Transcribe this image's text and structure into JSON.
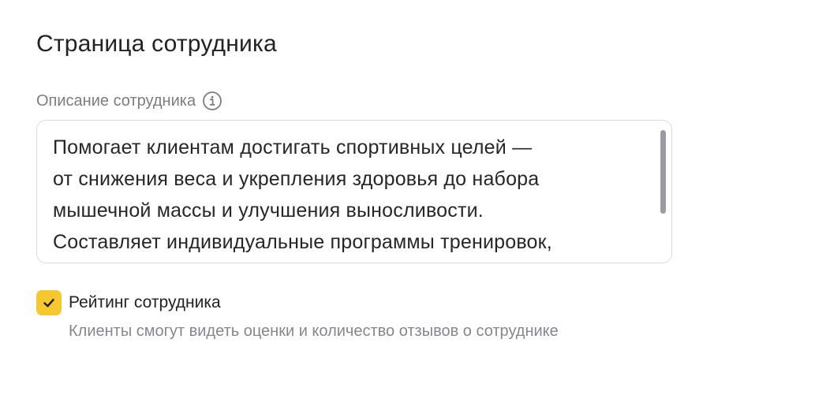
{
  "page": {
    "title": "Страница сотрудника"
  },
  "description_field": {
    "label": "Описание сотрудника",
    "info_icon": "info-icon",
    "value": "Помогает клиентам достигать спортивных целей —\nот снижения веса и укрепления здоровья до набора\nмышечной массы и улучшения выносливости.\nСоставляет индивидуальные программы тренировок,"
  },
  "rating_option": {
    "checked": true,
    "label": "Рейтинг сотрудника",
    "hint": "Клиенты смогут видеть оценки и количество отзывов о сотруднике",
    "check_icon": "check-icon"
  },
  "colors": {
    "checkbox_accent": "#f5c832",
    "label_muted": "#7c7c85",
    "border": "#dcdce0"
  }
}
